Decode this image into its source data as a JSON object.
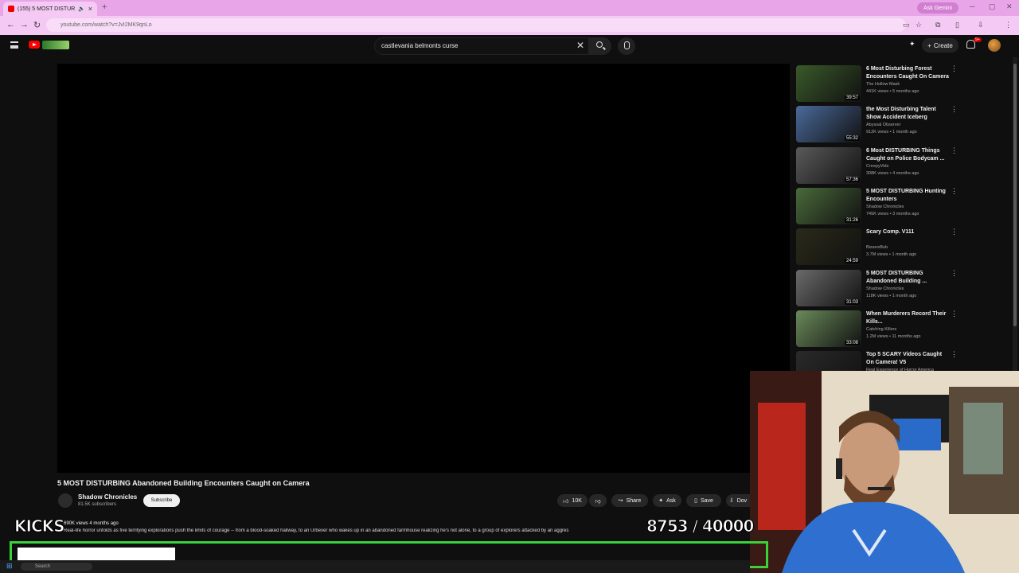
{
  "browser": {
    "tab_title": "(155) 5 MOST DISTURBIN...",
    "url": "youtube.com/watch?v=JvI2MK9qnLo",
    "gemini_label": "Ask Gemini"
  },
  "header": {
    "search_query": "castlevania belmonts curse",
    "create_label": "Create",
    "notif_count": "9+"
  },
  "video": {
    "title": "5 MOST DISTURBING Abandoned Building Encounters Caught on Camera",
    "channel": "Shadow Chronicles",
    "subscribers": "81.5K subscribers",
    "subscribe_label": "Subscribe",
    "likes": "10K",
    "share_label": "Share",
    "ask_label": "Ask",
    "save_label": "Save",
    "download_label": "Dov",
    "views": "690K views  4 months ago",
    "description": "Real-life horror unfolds as five terrifying explorations push the limits of courage -- from a blood-soaked hallway, to an Urbexer who wakes up in an abandoned farmhouse realizing he's not alone, to a group of explorers attacked by an aggres"
  },
  "sidebar": {
    "items": [
      {
        "title": "6 Most Disturbing Forest Encounters Caught On Camera",
        "channel": "The Hollow Mask",
        "meta": "441K views • 5 months ago",
        "duration": "39:57",
        "thumb_color": "#3a5a2a"
      },
      {
        "title": "the Most Disturbing Talent Show Accident Iceberg",
        "channel": "Abyssal Observer",
        "meta": "912K views • 1 month ago",
        "duration": "55:32",
        "thumb_color": "#4a6a9a"
      },
      {
        "title": "6 Most DISTURBING Things Caught on Police Bodycam ...",
        "channel": "CreepyVids",
        "meta": "308K views • 4 months ago",
        "duration": "57:36",
        "thumb_color": "#5a5a5a"
      },
      {
        "title": "5 MOST DISTURBING Hunting Encounters",
        "channel": "Shadow Chronicles",
        "meta": "745K views • 3 months ago",
        "duration": "31:26",
        "thumb_color": "#4a6a3a"
      },
      {
        "title": "Scary Comp. V111",
        "channel": "BizarreBub",
        "meta": "3.7M views • 1 month ago",
        "duration": "24:59",
        "thumb_color": "#2a2a1a"
      },
      {
        "title": "5 MOST DISTURBING Abandoned Building ...",
        "channel": "Shadow Chronicles",
        "meta": "118K views • 1 month ago",
        "duration": "31:03",
        "thumb_color": "#6a6a6a"
      },
      {
        "title": "When Murderers Record Their Kills...",
        "channel": "Catching Killers",
        "meta": "1.2M views • 11 months ago",
        "duration": "33:08",
        "thumb_color": "#6a8a5a"
      },
      {
        "title": "Top 5 SCARY Videos Caught On Camera! V5",
        "channel": "Real Experience of Horror America",
        "meta": "",
        "duration": "",
        "thumb_color": "#2a2a2a"
      }
    ]
  },
  "overlay": {
    "kicks_label": "KICKS",
    "counter": "8753  / 40000"
  },
  "taskbar": {
    "search_label": "Search"
  }
}
